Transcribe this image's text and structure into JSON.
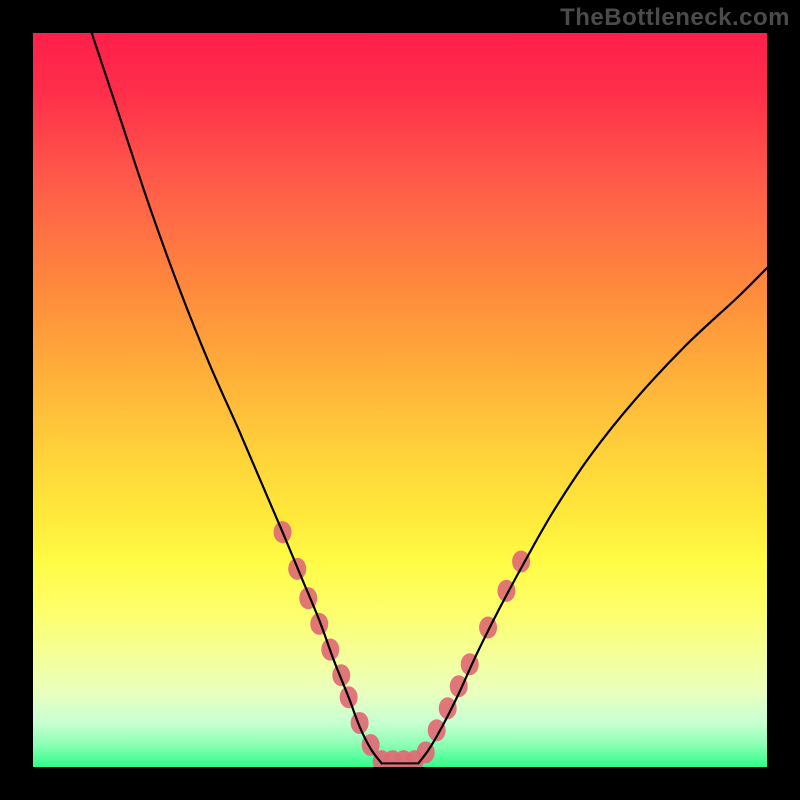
{
  "watermark": "TheBottleneck.com",
  "chart_data": {
    "type": "line",
    "title": "",
    "xlabel": "",
    "ylabel": "",
    "xlim": [
      0,
      100
    ],
    "ylim": [
      0,
      100
    ],
    "series": [
      {
        "name": "left-curve",
        "x": [
          8,
          12,
          16,
          20,
          24,
          28,
          31,
          34,
          36.5,
          39,
          41,
          43,
          44.5,
          46,
          47.5
        ],
        "y": [
          100,
          88,
          76,
          65,
          55,
          46,
          39,
          32,
          26,
          20,
          14.5,
          9.5,
          5.5,
          2.5,
          0.5
        ]
      },
      {
        "name": "right-curve",
        "x": [
          52.5,
          54,
          56,
          58,
          60.5,
          63.5,
          67,
          71,
          76,
          82,
          89,
          96,
          100
        ],
        "y": [
          0.5,
          2.5,
          6,
          10,
          15.5,
          21.5,
          28,
          35,
          42.5,
          50,
          57.5,
          64,
          68
        ]
      },
      {
        "name": "bottom-flat",
        "x": [
          47.5,
          52.5
        ],
        "y": [
          0.5,
          0.5
        ]
      }
    ],
    "markers": {
      "name": "highlight-dots",
      "color": "#e06a74",
      "points": [
        {
          "along": "left-curve",
          "x": 34,
          "y": 32
        },
        {
          "along": "left-curve",
          "x": 36,
          "y": 27
        },
        {
          "along": "left-curve",
          "x": 37.5,
          "y": 23
        },
        {
          "along": "left-curve",
          "x": 39,
          "y": 19.5
        },
        {
          "along": "left-curve",
          "x": 40.5,
          "y": 16
        },
        {
          "along": "left-curve",
          "x": 42,
          "y": 12.5
        },
        {
          "along": "left-curve",
          "x": 43,
          "y": 9.5
        },
        {
          "along": "left-curve",
          "x": 44.5,
          "y": 6
        },
        {
          "along": "left-curve",
          "x": 46,
          "y": 3
        },
        {
          "along": "bottom-flat",
          "x": 47.5,
          "y": 0.8
        },
        {
          "along": "bottom-flat",
          "x": 49,
          "y": 0.8
        },
        {
          "along": "bottom-flat",
          "x": 50.5,
          "y": 0.8
        },
        {
          "along": "bottom-flat",
          "x": 52,
          "y": 0.8
        },
        {
          "along": "right-curve",
          "x": 53.5,
          "y": 2
        },
        {
          "along": "right-curve",
          "x": 55,
          "y": 5
        },
        {
          "along": "right-curve",
          "x": 56.5,
          "y": 8
        },
        {
          "along": "right-curve",
          "x": 58,
          "y": 11
        },
        {
          "along": "right-curve",
          "x": 59.5,
          "y": 14
        },
        {
          "along": "right-curve",
          "x": 62,
          "y": 19
        },
        {
          "along": "right-curve",
          "x": 64.5,
          "y": 24
        },
        {
          "along": "right-curve",
          "x": 66.5,
          "y": 28
        }
      ]
    },
    "colors": {
      "curve": "#000000",
      "marker": "#e06a74",
      "background_top": "#ff1f4a",
      "background_bottom": "#2dff8a",
      "frame": "#000000"
    }
  }
}
